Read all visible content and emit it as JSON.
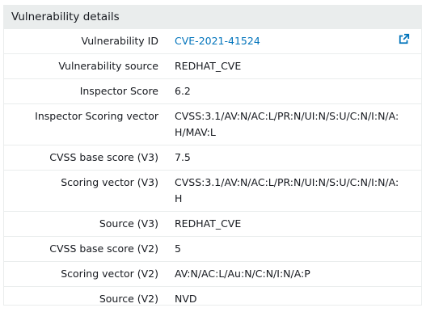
{
  "panel": {
    "title": "Vulnerability details"
  },
  "rows": [
    {
      "label": "Vulnerability ID",
      "value": "CVE-2021-41524"
    },
    {
      "label": "Vulnerability source",
      "value": "REDHAT_CVE"
    },
    {
      "label": "Inspector Score",
      "value": "6.2"
    },
    {
      "label": "Inspector Scoring vector",
      "value": "CVSS:3.1/AV:N/AC:L/PR:N/UI:N/S:U/C:N/I:N/A:H/MAV:L"
    },
    {
      "label": "CVSS base score (V3)",
      "value": "7.5"
    },
    {
      "label": "Scoring vector (V3)",
      "value": "CVSS:3.1/AV:N/AC:L/PR:N/UI:N/S:U/C:N/I:N/A:H"
    },
    {
      "label": "Source (V3)",
      "value": "REDHAT_CVE"
    },
    {
      "label": "CVSS base score (V2)",
      "value": "5"
    },
    {
      "label": "Scoring vector (V2)",
      "value": "AV:N/AC:L/Au:N/C:N/I:N/A:P"
    },
    {
      "label": "Source (V2)",
      "value": "NVD"
    }
  ],
  "icons": {
    "external_link": "external-link-icon"
  },
  "colors": {
    "header_bg": "#eaeded",
    "link": "#0073bb",
    "text": "#16191f",
    "divider": "#eaeded"
  }
}
